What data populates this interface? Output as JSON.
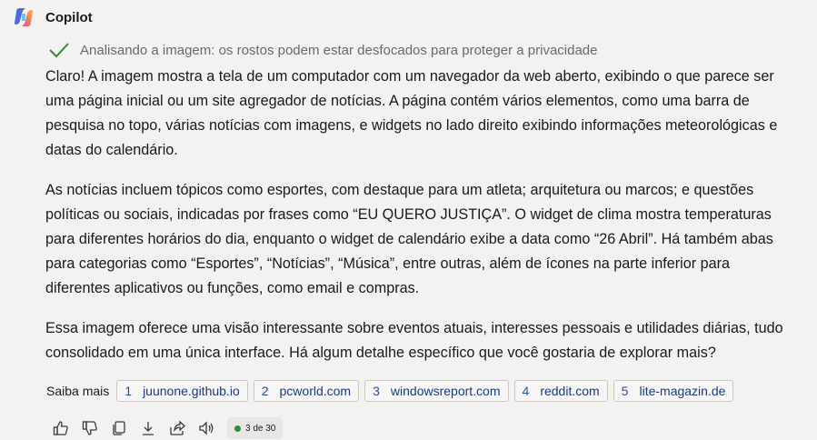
{
  "header": {
    "title": "Copilot",
    "logo_icon": "copilot-logo-icon"
  },
  "status": {
    "text": "Analisando a imagem: os rostos podem estar desfocados para proteger a privacidade",
    "icon": "checkmark-icon",
    "color": "#2e8b3e"
  },
  "message": {
    "paragraphs": [
      "Claro! A imagem mostra a tela de um computador com um navegador da web aberto, exibindo o que parece ser uma página inicial ou um site agregador de notícias. A página contém vários elementos, como uma barra de pesquisa no topo, várias notícias com imagens, e widgets no lado direito exibindo informações meteorológicas e datas do calendário.",
      "As notícias incluem tópicos como esportes, com destaque para um atleta; arquitetura ou marcos; e questões políticas ou sociais, indicadas por frases como “EU QUERO JUSTIÇA”. O widget de clima mostra temperaturas para diferentes horários do dia, enquanto o widget de calendário exibe a data como “26 Abril”. Há também abas para categorias como “Esportes”, “Notícias”, “Música”, entre outras, além de ícones na parte inferior para diferentes aplicativos ou funções, como email e compras.",
      "Essa imagem oferece uma visão interessante sobre eventos atuais, interesses pessoais e utilidades diárias, tudo consolidado em uma única interface. Há algum detalhe específico que você gostaria de explorar mais?"
    ]
  },
  "sources": {
    "label": "Saiba mais",
    "items": [
      {
        "num": "1",
        "label": "juunone.github.io"
      },
      {
        "num": "2",
        "label": "pcworld.com"
      },
      {
        "num": "3",
        "label": "windowsreport.com"
      },
      {
        "num": "4",
        "label": "reddit.com"
      },
      {
        "num": "5",
        "label": "lite-magazin.de"
      }
    ]
  },
  "actions": {
    "icons": [
      "thumbs-up-icon",
      "thumbs-down-icon",
      "copy-icon",
      "download-icon",
      "share-icon",
      "speaker-icon"
    ],
    "counter": "3 de 30"
  },
  "colors": {
    "background": "#f3f2f1",
    "link": "#1a3a8c",
    "accent_green": "#2e8b3e"
  }
}
